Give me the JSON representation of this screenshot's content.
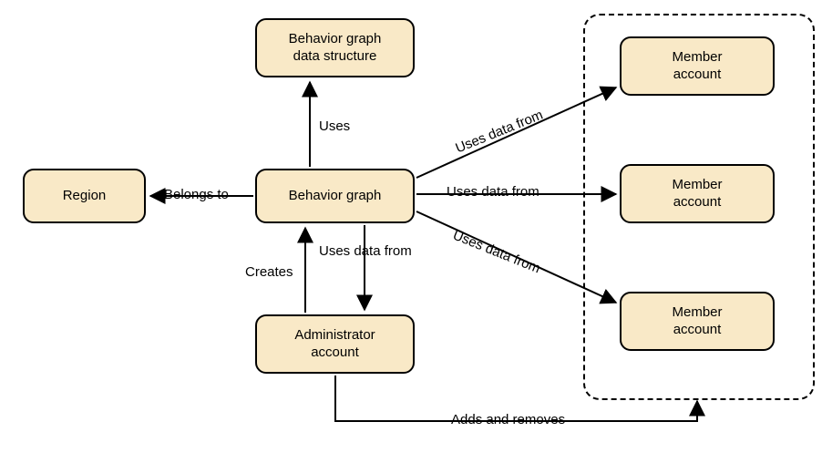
{
  "nodes": {
    "region": {
      "label": "Region"
    },
    "behavior_graph": {
      "label": "Behavior graph"
    },
    "behavior_graph_data_structure": {
      "label": "Behavior graph\ndata structure"
    },
    "administrator_account": {
      "label": "Administrator\naccount"
    },
    "member_account_1": {
      "label": "Member\naccount"
    },
    "member_account_2": {
      "label": "Member\naccount"
    },
    "member_account_3": {
      "label": "Member\naccount"
    }
  },
  "edges": {
    "belongs_to": {
      "label": "Belongs to"
    },
    "uses": {
      "label": "Uses"
    },
    "creates": {
      "label": "Creates"
    },
    "uses_data_from_admin": {
      "label": "Uses data from"
    },
    "uses_data_from_member1": {
      "label": "Uses data from"
    },
    "uses_data_from_member2": {
      "label": "Uses data from"
    },
    "uses_data_from_member3": {
      "label": "Uses data from"
    },
    "adds_and_removes": {
      "label": "Adds and removes"
    }
  }
}
